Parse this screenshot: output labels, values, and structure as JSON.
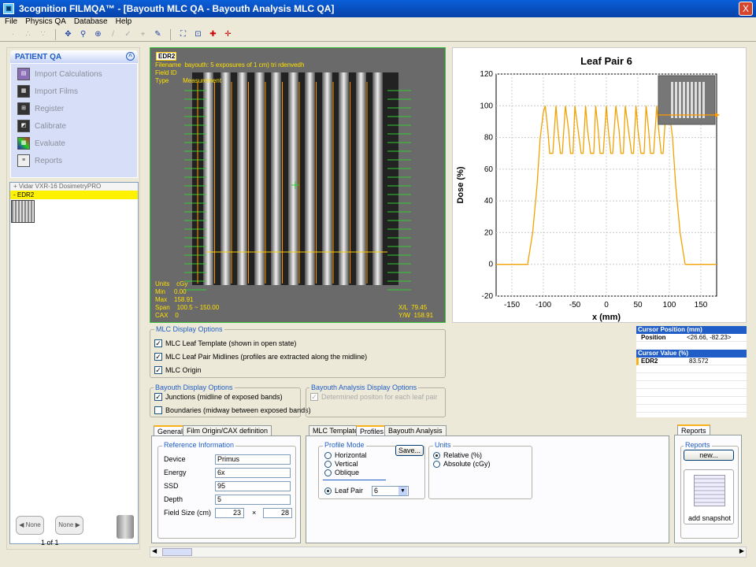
{
  "window": {
    "title": "3cognition FILMQA™ - [Bayouth MLC QA - Bayouth Analysis MLC QA]",
    "close": "X"
  },
  "menu": [
    "File",
    "Physics QA",
    "Database",
    "Help"
  ],
  "patient_qa": {
    "title": "PATIENT QA",
    "items": [
      "Import Calculations",
      "Import Films",
      "Register",
      "Calibrate",
      "Evaluate",
      "Reports"
    ]
  },
  "film_list": {
    "scanner": "+ Vidar VXR-16 DosimetryPRO",
    "selected": "- EDR2"
  },
  "nav": {
    "prev": "None",
    "next": "None",
    "page": "1 of 1"
  },
  "image": {
    "label": "EDR2",
    "info_top": "Filename  bayouth: 5 exposures of 1 cm) tri rdenvedh\nField ID\nType        Measurement",
    "info_bottom": "Units    cGy\nMin     0.00\nMax    158.91\nSpan    100.5 ~ 150.00\nCAX    0",
    "readout_right": "X/L  79.45\nY/W  158.91"
  },
  "chart_data": {
    "type": "line",
    "title": "Leaf Pair 6",
    "xlabel": "x (mm)",
    "ylabel": "Dose (%)",
    "xlim": [
      -175,
      175
    ],
    "ylim": [
      -20,
      120
    ],
    "xticks": [
      -150,
      -100,
      -50,
      0,
      50,
      100,
      150
    ],
    "yticks": [
      -20,
      0,
      20,
      40,
      60,
      80,
      100,
      120
    ],
    "grid": true,
    "color": "#f4a100",
    "x": [
      -175,
      -125,
      -117,
      -110,
      -105,
      -100,
      -97,
      -93,
      -90,
      -85,
      -80,
      -77,
      -73,
      -70,
      -65,
      -60,
      -57,
      -53,
      -50,
      -45,
      -40,
      -37,
      -33,
      -30,
      -25,
      -20,
      -17,
      -13,
      -10,
      -5,
      0,
      3,
      7,
      10,
      15,
      20,
      23,
      27,
      30,
      35,
      40,
      43,
      47,
      50,
      55,
      60,
      63,
      67,
      70,
      75,
      80,
      83,
      87,
      90,
      95,
      100,
      105,
      110,
      117,
      125,
      175
    ],
    "y": [
      0,
      0,
      20,
      50,
      80,
      96,
      100,
      85,
      70,
      70,
      100,
      85,
      70,
      70,
      100,
      85,
      70,
      70,
      100,
      85,
      70,
      70,
      100,
      85,
      70,
      70,
      100,
      85,
      70,
      70,
      100,
      85,
      70,
      70,
      100,
      85,
      70,
      70,
      100,
      85,
      70,
      70,
      100,
      85,
      70,
      70,
      100,
      85,
      70,
      70,
      100,
      85,
      70,
      70,
      100,
      96,
      80,
      50,
      20,
      0,
      0
    ]
  },
  "mlc_display": {
    "title": "MLC Display Options",
    "options": [
      "MLC Leaf Template (shown in open state)",
      "MLC Leaf Pair Midlines (profiles are extracted along the midline)",
      "MLC Origin"
    ]
  },
  "bayouth_display": {
    "title": "Bayouth Display Options",
    "options": [
      "Junctions (midline of exposed bands)",
      "Boundaries (midway between exposed bands)"
    ]
  },
  "bayouth_analysis": {
    "title": "Bayouth Analysis Display Options",
    "option": "Determined positon for each leaf pair"
  },
  "cursor": {
    "position_header": "Cursor Position (mm)",
    "position_label": "Position",
    "position_value": "<26.66, -82.23>",
    "value_header": "Cursor Value (%)",
    "film": "EDR2",
    "value": "83.572"
  },
  "left_tabs": [
    "General",
    "Film Origin/CAX definition"
  ],
  "reference": {
    "title": "Reference Information",
    "fields": [
      {
        "label": "Device",
        "value": "Primus"
      },
      {
        "label": "Energy",
        "value": "6x"
      },
      {
        "label": "SSD",
        "value": "95"
      },
      {
        "label": "Depth",
        "value": "5"
      }
    ],
    "field_size_label": "Field Size (cm)",
    "field_size_x": "23",
    "field_size_sep": "×",
    "field_size_y": "28"
  },
  "mid_tabs": [
    "MLC Template",
    "Profiles",
    "Bayouth Analysis"
  ],
  "profile_mode": {
    "title": "Profile Mode",
    "options": [
      "Horizontal",
      "Vertical",
      "Oblique"
    ],
    "save": "Save...",
    "leaf_pair_label": "Leaf Pair",
    "leaf_pair_value": "6"
  },
  "units": {
    "title": "Units",
    "options": [
      "Relative (%)",
      "Absolute (cGy)"
    ]
  },
  "reports": {
    "tab": "Reports",
    "title": "Reports",
    "new": "new...",
    "snapshot": "add snapshot"
  }
}
